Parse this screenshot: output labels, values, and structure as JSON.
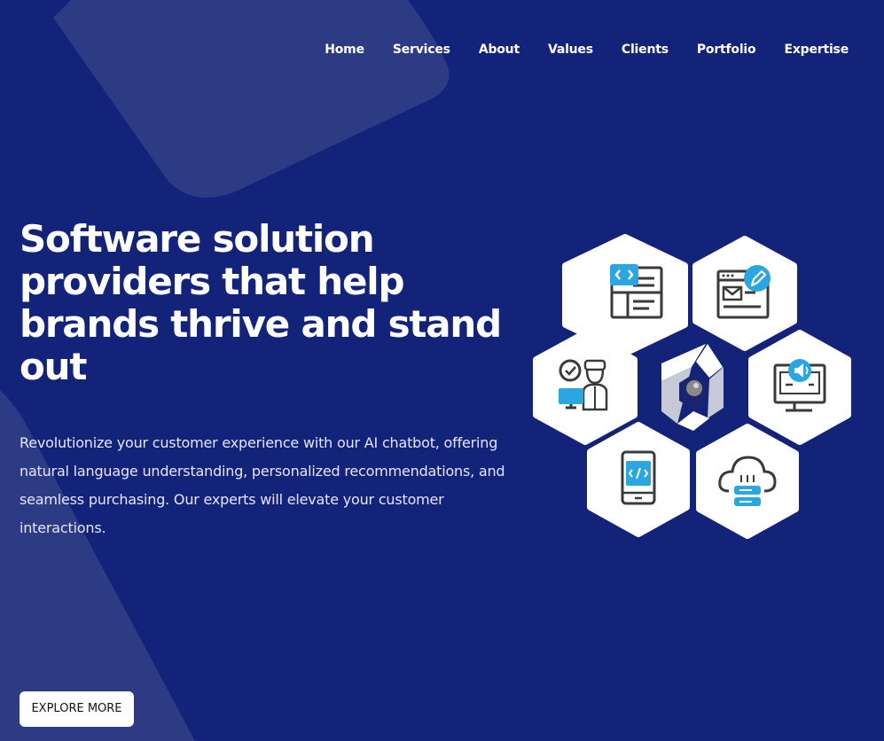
{
  "nav": {
    "items": [
      {
        "label": "Home"
      },
      {
        "label": "Services"
      },
      {
        "label": "About"
      },
      {
        "label": "Values"
      },
      {
        "label": "Clients"
      },
      {
        "label": "Portfolio"
      },
      {
        "label": "Expertise"
      }
    ]
  },
  "hero": {
    "title": "Software solution providers that help brands thrive and stand out",
    "description": "Revolutionize your customer experience with our AI chatbot, offering natural language understanding, personalized recommendations, and seamless purchasing. Our experts will elevate your customer interactions.",
    "cta_label": "EXPLORE MORE"
  },
  "illustration": {
    "icons": [
      "code-editor-icon",
      "web-design-icon",
      "developer-icon",
      "logo-center-icon",
      "digital-marketing-icon",
      "mobile-development-icon",
      "cloud-server-icon"
    ]
  },
  "colors": {
    "background": "#14237a",
    "decoration": "#2d3b85",
    "accent": "#2aa7e0",
    "icon_stroke": "#3a3a3a",
    "hexagon": "#ffffff",
    "cta_background": "#ffffff",
    "cta_text": "#141414"
  }
}
